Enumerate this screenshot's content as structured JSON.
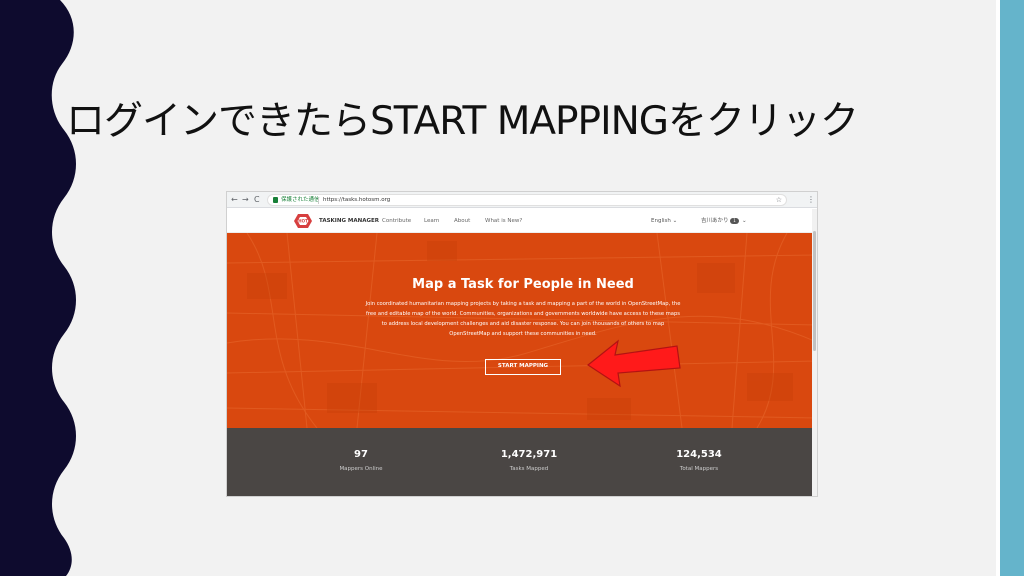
{
  "slide": {
    "title": "ログインできたらSTART MAPPINGをクリック",
    "colors": {
      "left_wave": "#0e0b2e",
      "right_bar": "#65b4cb",
      "arrow": "#ff1a1a"
    }
  },
  "browser": {
    "back_icon": "back-arrow-icon",
    "forward_icon": "forward-arrow-icon",
    "reload_icon": "reload-icon",
    "secure_label": "保護された通信",
    "url": "https://tasks.hotosm.org",
    "star_icon": "star-icon",
    "menu_icon": "kebab-menu-icon"
  },
  "site": {
    "brand": "TASKING MANAGER",
    "logo_text": "HOT",
    "nav": [
      "Contribute",
      "Learn",
      "About",
      "What is New?"
    ],
    "language": "English",
    "user_name": "吉川あかり",
    "user_badge": "1",
    "hero_title": "Map a Task for People in Need",
    "hero_text": "Join coordinated humanitarian mapping projects by taking a task and mapping a part of the world in OpenStreetMap, the free and editable map of the world. Communities, organizations and governments worldwide have access to these maps to address local development challenges and aid disaster response. You can join thousands of others to map OpenStreetMap and support these communities in need.",
    "start_button": "START MAPPING",
    "colors": {
      "hero": "#d9480f",
      "stats_bg": "#4a4644",
      "logo": "#d73f3f"
    },
    "stats": [
      {
        "value": "97",
        "label": "Mappers Online"
      },
      {
        "value": "1,472,971",
        "label": "Tasks Mapped"
      },
      {
        "value": "124,534",
        "label": "Total Mappers"
      }
    ]
  }
}
